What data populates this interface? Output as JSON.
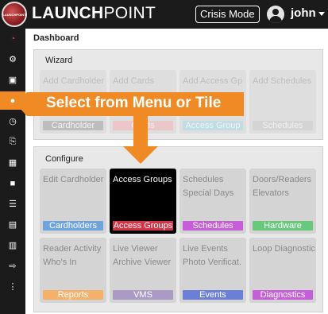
{
  "header": {
    "brand_bold": "LAUNCH",
    "brand_thin": "POINT",
    "logo_text": "LAUNCHPOINT",
    "crisis_label": "Crisis Mode",
    "username": "john"
  },
  "sidebar": {
    "items": [
      {
        "icon": "dashboard-icon",
        "glyph": "◔"
      },
      {
        "icon": "gear-icon",
        "glyph": "⚙"
      },
      {
        "icon": "cardholder-icon",
        "glyph": "▣"
      },
      {
        "icon": "users-icon",
        "glyph": "●"
      },
      {
        "icon": "clock-icon",
        "glyph": "◷"
      },
      {
        "icon": "key-icon",
        "glyph": "⎘"
      },
      {
        "icon": "door-icon",
        "glyph": "▦"
      },
      {
        "icon": "camera-icon",
        "glyph": "■"
      },
      {
        "icon": "report-icon",
        "glyph": "☰"
      },
      {
        "icon": "diagnostics-icon",
        "glyph": "▤"
      },
      {
        "icon": "calendar-icon",
        "glyph": "▥"
      },
      {
        "icon": "logout-icon",
        "glyph": "⇨"
      },
      {
        "icon": "more-icon",
        "glyph": "⋮"
      }
    ]
  },
  "breadcrumb": "Dashboard",
  "wizard": {
    "title": "Wizard",
    "tiles": [
      {
        "lines": [
          "Add Cardholder"
        ],
        "bar": "Cardholder",
        "color": "#8a8a8a"
      },
      {
        "lines": [
          "Add Cards"
        ],
        "bar": "Cards",
        "color": "#f1a0a6"
      },
      {
        "lines": [
          "Add Access Gp"
        ],
        "bar": "Access Group",
        "color": "#8fd0de"
      },
      {
        "lines": [
          "Add Schedules"
        ],
        "bar": "Schedules",
        "color": "#bdbdbd"
      }
    ]
  },
  "configure": {
    "title": "Configure",
    "tiles": [
      {
        "lines": [
          "Edit Cardholder"
        ],
        "bar": "Cardholders",
        "color": "#6fa3dc"
      },
      {
        "lines": [
          "Access Groups"
        ],
        "bar": "Access Groups",
        "color": "#d33446"
      },
      {
        "lines": [
          "Schedules",
          "Special Days"
        ],
        "bar": "Schedules",
        "color": "#c65ed9"
      },
      {
        "lines": [
          "Doors/Readers",
          "Elevators"
        ],
        "bar": "Hardware",
        "color": "#68c97b"
      },
      {
        "lines": [
          "Reader Activity",
          "Who's In"
        ],
        "bar": "Reports",
        "color": "#f5b06a"
      },
      {
        "lines": [
          "Live Viewer",
          "Archive Viewer"
        ],
        "bar": "VMS",
        "color": "#a99bc4"
      },
      {
        "lines": [
          "Live Events",
          "Photo Verificat."
        ],
        "bar": "Events",
        "color": "#6b7fd6"
      },
      {
        "lines": [
          "Loop Diagnostic"
        ],
        "bar": "Diagnostics",
        "color": "#c65ed9"
      }
    ]
  },
  "callout": {
    "text": "Select from Menu or Tile",
    "color": "#f08a24"
  }
}
